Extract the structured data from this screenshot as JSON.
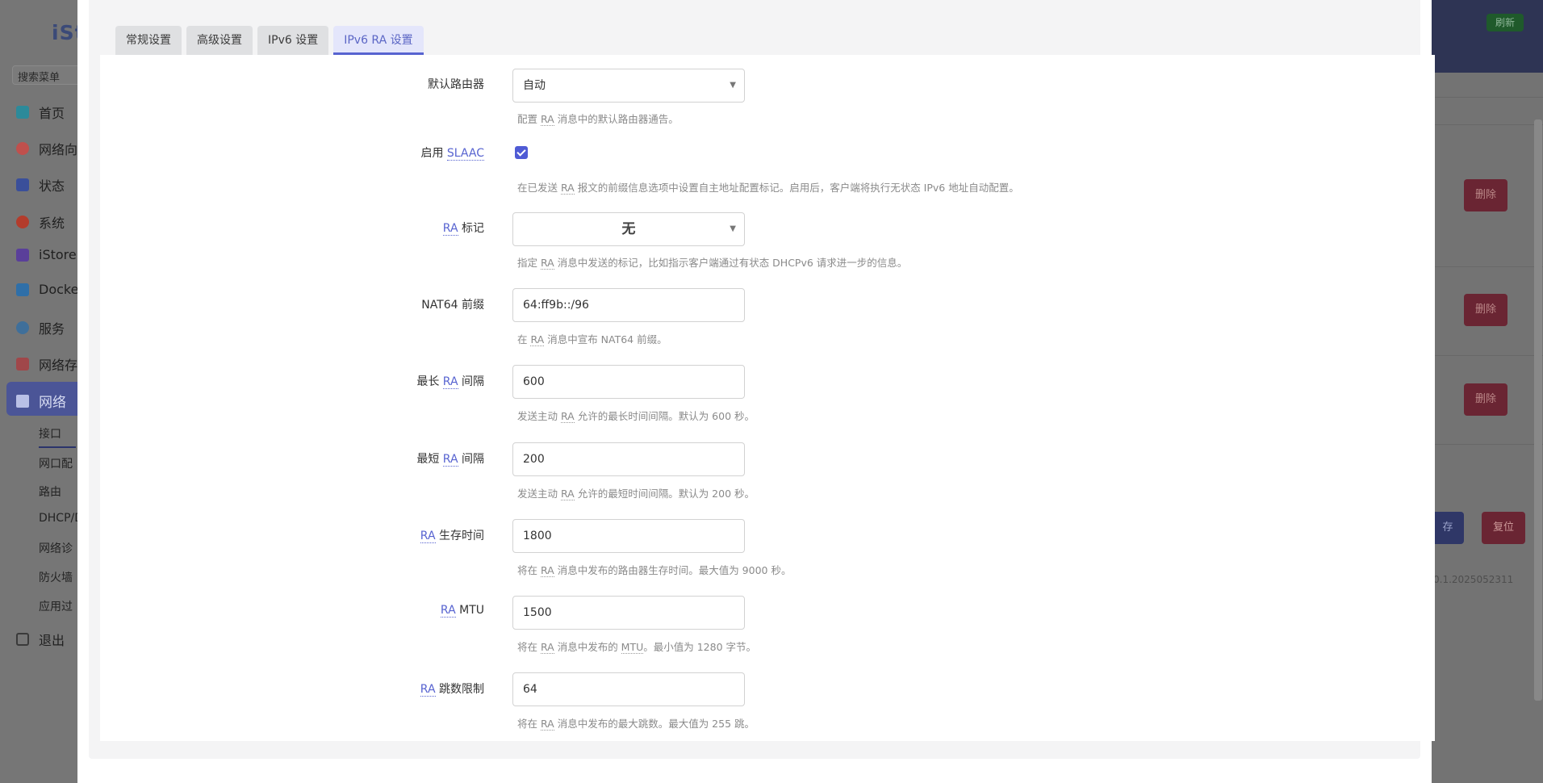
{
  "background": {
    "logo": "iSt",
    "search_placeholder": "搜索菜单",
    "nav": [
      {
        "label": "首页",
        "icon": "dashboard-icon",
        "color": "#2c8a9a"
      },
      {
        "label": "网络向",
        "icon": "wizard-icon",
        "color": "#c0504d"
      },
      {
        "label": "状态",
        "icon": "status-grid-icon",
        "color": "#3a4f9a"
      },
      {
        "label": "系统",
        "icon": "gear-icon",
        "color": "#b33c2c"
      },
      {
        "label": "iStore",
        "icon": "store-icon",
        "color": "#5a3f9a"
      },
      {
        "label": "Docke",
        "icon": "docker-icon",
        "color": "#2f6fa8"
      },
      {
        "label": "服务",
        "icon": "services-icon",
        "color": "#3f6f9a"
      },
      {
        "label": "网络存",
        "icon": "storage-icon",
        "color": "#a0474a"
      }
    ],
    "active_nav": "网络",
    "subnav": [
      "接口",
      "网口配",
      "路由",
      "DHCP/D",
      "网络诊",
      "防火墙",
      "应用过"
    ],
    "logout": "退出",
    "refresh_label": "刷新",
    "delete_label": "删除",
    "save_label": "存",
    "reset_label": "复位",
    "version_text": "0.1.2025052311"
  },
  "tabs": [
    {
      "label": "常规设置",
      "active": false
    },
    {
      "label": "高级设置",
      "active": false
    },
    {
      "label": "IPv6 设置",
      "active": false
    },
    {
      "label": "IPv6 RA 设置",
      "active": true
    }
  ],
  "form": {
    "default_router": {
      "label": "默认路由器",
      "value": "自动",
      "desc_pre": "配置 ",
      "desc_abbr": "RA",
      "desc_post": " 消息中的默认路由器通告。"
    },
    "slaac": {
      "label_pre": "启用 ",
      "label_abbr": "SLAAC",
      "checked": true,
      "desc_pre": "在已发送 ",
      "desc_abbr": "RA",
      "desc_post": " 报文的前缀信息选项中设置自主地址配置标记。启用后，客户端将执行无状态 IPv6 地址自动配置。"
    },
    "ra_flags": {
      "label_abbr": "RA",
      "label_post": " 标记",
      "value": "无",
      "desc_pre": "指定 ",
      "desc_abbr": "RA",
      "desc_post": " 消息中发送的标记，比如指示客户端通过有状态 DHCPv6 请求进一步的信息。"
    },
    "nat64": {
      "label": "NAT64 前缀",
      "value": "64:ff9b::/96",
      "desc_pre": "在 ",
      "desc_abbr": "RA",
      "desc_post": " 消息中宣布 NAT64 前缀。"
    },
    "max_interval": {
      "label_pre": "最长 ",
      "label_abbr": "RA",
      "label_post": " 间隔",
      "value": "600",
      "desc_pre": "发送主动 ",
      "desc_abbr": "RA",
      "desc_post": " 允许的最长时间间隔。默认为 600 秒。"
    },
    "min_interval": {
      "label_pre": "最短 ",
      "label_abbr": "RA",
      "label_post": " 间隔",
      "value": "200",
      "desc_pre": "发送主动 ",
      "desc_abbr": "RA",
      "desc_post": " 允许的最短时间间隔。默认为 200 秒。"
    },
    "lifetime": {
      "label_abbr": "RA",
      "label_post": " 生存时间",
      "value": "1800",
      "desc_pre": "将在 ",
      "desc_abbr": "RA",
      "desc_post": " 消息中发布的路由器生存时间。最大值为 9000 秒。"
    },
    "mtu": {
      "label_abbr": "RA",
      "label_post": " MTU",
      "value": "1500",
      "desc_pre": "将在 ",
      "desc_abbr": "RA",
      "desc_mid": " 消息中发布的 ",
      "desc_abbr2": "MTU",
      "desc_post": "。最小值为 1280 字节。"
    },
    "hop_limit": {
      "label_abbr": "RA",
      "label_post": " 跳数限制",
      "value": "64",
      "desc_pre": "将在 ",
      "desc_abbr": "RA",
      "desc_post": " 消息中发布的最大跳数。最大值为 255 跳。"
    }
  }
}
